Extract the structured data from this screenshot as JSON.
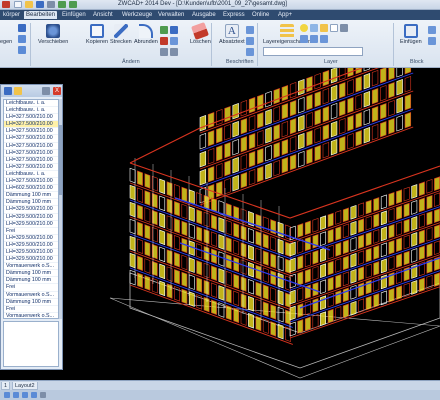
{
  "window": {
    "title": "ZWCAD+ 2014 Dev - [D:\\Kunden\\ufb\\2001_09_27\\gesamt.dwg]"
  },
  "menu": {
    "items": [
      "körper",
      "Bearbeiten",
      "Einfügen",
      "Ansicht",
      "Werkzeuge",
      "Verwalten",
      "Ausgabe",
      "Express",
      "Online",
      "App+"
    ],
    "active_index": 1
  },
  "ribbon": {
    "buttons": {
      "move": "Verschieben",
      "copy": "Kopieren",
      "stretch": "Strecken",
      "fillet": "Abrunden",
      "erase": "Löschen",
      "dimtext": "Absatztext",
      "layer_props": "Layereigenschaften",
      "insert": "Einfügen",
      "bend": "egen"
    },
    "groups": {
      "modify": "Ändern",
      "annotate": "Beschriften",
      "layer": "Layer",
      "block": "Block"
    }
  },
  "palette": {
    "close_glyph": "X",
    "rows": [
      "Leichtbauw.. i. a.",
      "Leichtbauw.. i. a.",
      "LH=327.500/210.00",
      "LH=327.500/210.00",
      "LH=327.500/210.00",
      "LH=327.500/210.00",
      "LH=327.500/210.00",
      "LH=327.500/210.00",
      "LH=327.500/210.00",
      "LH=327.500/210.00",
      "Leichtbauw.. i. a.",
      "LH=327.500/210.00",
      "LH=602.500/210.00",
      "Dämmung 100 mm",
      "Dämmung 100 mm",
      "LH=329.500/210.00",
      "LH=329.500/210.00",
      "LH=329.500/210.00",
      "Frei",
      "LH=329.500/210.00",
      "LH=329.500/210.00",
      "LH=329.500/210.00",
      "LH=329.500/210.00",
      "Vormauerwerk o.S...",
      "Dämmung 100 mm",
      "Dämmung 100 mm",
      "Frei",
      "Vormauerwerk o.S...",
      "Dämmung 100 mm",
      "Frei",
      "Vormauerwerk o.S...",
      "Dämmung 100 mm",
      "Dämmung 100 mm"
    ],
    "selected_index": 3
  },
  "layout_tabs": [
    "1",
    "Layout2"
  ],
  "colors": {
    "drawing_bg": "#000000",
    "walls": "#d8341f",
    "windows": "#f0e020",
    "frames": "#ffffff",
    "beams": "#2f3cf0",
    "grid": "#b9b9b9"
  }
}
